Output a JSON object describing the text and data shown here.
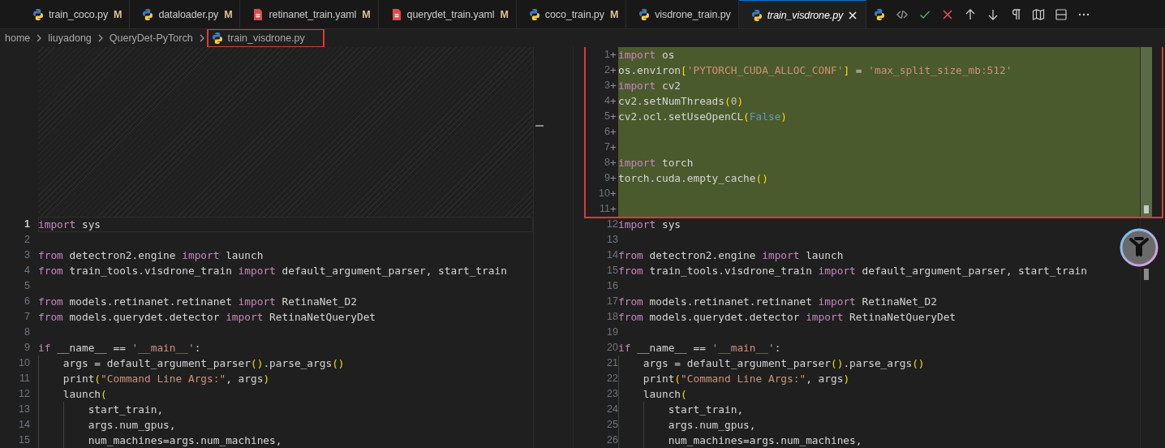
{
  "tabs": [
    {
      "label": "train_coco.py",
      "kind": "python",
      "status": "M",
      "selected": false,
      "preview": false
    },
    {
      "label": "dataloader.py",
      "kind": "python",
      "status": "M",
      "selected": false,
      "preview": false
    },
    {
      "label": "retinanet_train.yaml",
      "kind": "yaml",
      "status": "M",
      "selected": false,
      "preview": false
    },
    {
      "label": "querydet_train.yaml",
      "kind": "yaml",
      "status": "M",
      "selected": false,
      "preview": false
    },
    {
      "label": "coco_train.py",
      "kind": "python",
      "status": "M",
      "selected": false,
      "preview": false
    },
    {
      "label": "visdrone_train.py",
      "kind": "python",
      "selected": false,
      "preview": false
    },
    {
      "label": "train_visdrone.py",
      "kind": "python",
      "selected": true,
      "preview": true
    }
  ],
  "toolbar": [
    {
      "kind": "python"
    },
    {
      "kind": "code"
    },
    {
      "kind": "accept"
    },
    {
      "kind": "reject"
    },
    {
      "kind": "up"
    },
    {
      "kind": "down"
    },
    {
      "kind": "pilcrow"
    },
    {
      "kind": "map"
    },
    {
      "kind": "split"
    },
    {
      "kind": "more"
    }
  ],
  "breadcrumb": [
    {
      "label": "home",
      "kind": "folder"
    },
    {
      "label": "liuyadong",
      "kind": "folder"
    },
    {
      "label": "QueryDet-PyTorch",
      "kind": "folder"
    },
    {
      "label": "train_visdrone.py",
      "kind": "python",
      "annotated": true
    }
  ],
  "left_pane": {
    "lines": [
      {
        "number": "1",
        "current": true,
        "tokens": [
          {
            "kind": "kw",
            "text": "import"
          },
          {
            "kind": "plain",
            "text": " sys"
          }
        ]
      },
      {
        "number": "2",
        "current": false
      },
      {
        "number": "3",
        "current": false,
        "tokens": [
          {
            "kind": "kw",
            "text": "from"
          },
          {
            "kind": "plain",
            "text": " detectron2.engine "
          },
          {
            "kind": "kw",
            "text": "import"
          },
          {
            "kind": "plain",
            "text": " launch"
          }
        ]
      },
      {
        "number": "4",
        "current": false,
        "tokens": [
          {
            "kind": "kw",
            "text": "from"
          },
          {
            "kind": "plain",
            "text": " train_tools.visdrone_train "
          },
          {
            "kind": "kw",
            "text": "import"
          },
          {
            "kind": "plain",
            "text": " default_argument_parser, start_train"
          }
        ]
      },
      {
        "number": "5",
        "current": false
      },
      {
        "number": "6",
        "current": false,
        "tokens": [
          {
            "kind": "kw",
            "text": "from"
          },
          {
            "kind": "plain",
            "text": " models.retinanet.retinanet "
          },
          {
            "kind": "kw",
            "text": "import"
          },
          {
            "kind": "plain",
            "text": " RetinaNet_D2"
          }
        ]
      },
      {
        "number": "7",
        "current": false,
        "tokens": [
          {
            "kind": "kw",
            "text": "from"
          },
          {
            "kind": "plain",
            "text": " models.querydet.detector "
          },
          {
            "kind": "kw",
            "text": "import"
          },
          {
            "kind": "plain",
            "text": " RetinaNetQueryDet"
          }
        ]
      },
      {
        "number": "8",
        "current": false
      },
      {
        "number": "9",
        "current": false,
        "tokens": [
          {
            "kind": "kw",
            "text": "if"
          },
          {
            "kind": "plain",
            "text": " __name__ == "
          },
          {
            "kind": "str",
            "text": "'__main__'"
          },
          {
            "kind": "plain",
            "text": ":"
          }
        ]
      },
      {
        "number": "10",
        "current": false,
        "tokens": [
          {
            "kind": "plain",
            "text": "    args = default_argument_parser"
          },
          {
            "kind": "bracket",
            "text": "()"
          },
          {
            "kind": "plain",
            "text": ".parse_args"
          },
          {
            "kind": "bracket",
            "text": "()"
          }
        ]
      },
      {
        "number": "11",
        "current": false,
        "tokens": [
          {
            "kind": "plain",
            "text": "    print"
          },
          {
            "kind": "bracket",
            "text": "("
          },
          {
            "kind": "str",
            "text": "\"Command Line Args:\""
          },
          {
            "kind": "plain",
            "text": ", args"
          },
          {
            "kind": "bracket",
            "text": ")"
          }
        ]
      },
      {
        "number": "12",
        "current": false,
        "tokens": [
          {
            "kind": "plain",
            "text": "    launch"
          },
          {
            "kind": "bracket",
            "text": "("
          }
        ]
      },
      {
        "number": "13",
        "current": false,
        "tokens": [
          {
            "kind": "plain",
            "text": "        start_train,"
          }
        ]
      },
      {
        "number": "14",
        "current": false,
        "tokens": [
          {
            "kind": "plain",
            "text": "        args.num_gpus,"
          }
        ]
      },
      {
        "number": "15",
        "current": false,
        "tokens": [
          {
            "kind": "plain",
            "text": "        num_machines=args.num_machines,"
          }
        ]
      }
    ]
  },
  "right_pane": {
    "annotated": true,
    "lines": [
      {
        "number": "1",
        "marker": "+",
        "added": true,
        "tokens": [
          {
            "kind": "kw",
            "text": "import"
          },
          {
            "kind": "plain",
            "text": " os"
          }
        ]
      },
      {
        "number": "2",
        "marker": "+",
        "added": true,
        "tokens": [
          {
            "kind": "plain",
            "text": "os.environ"
          },
          {
            "kind": "bracket",
            "text": "["
          },
          {
            "kind": "str",
            "text": "'PYTORCH_CUDA_ALLOC_CONF'"
          },
          {
            "kind": "bracket",
            "text": "]"
          },
          {
            "kind": "plain",
            "text": " = "
          },
          {
            "kind": "str",
            "text": "'max_split_size_mb:512'"
          }
        ]
      },
      {
        "number": "3",
        "marker": "+",
        "added": true,
        "tokens": [
          {
            "kind": "kw",
            "text": "import"
          },
          {
            "kind": "plain",
            "text": " cv2"
          }
        ]
      },
      {
        "number": "4",
        "marker": "+",
        "added": true,
        "tokens": [
          {
            "kind": "plain",
            "text": "cv2.setNumThreads"
          },
          {
            "kind": "bracket",
            "text": "("
          },
          {
            "kind": "num",
            "text": "0"
          },
          {
            "kind": "bracket",
            "text": ")"
          }
        ]
      },
      {
        "number": "5",
        "marker": "+",
        "added": true,
        "tokens": [
          {
            "kind": "plain",
            "text": "cv2.ocl.setUseOpenCL"
          },
          {
            "kind": "bracket",
            "text": "("
          },
          {
            "kind": "const",
            "text": "False"
          },
          {
            "kind": "bracket",
            "text": ")"
          }
        ]
      },
      {
        "number": "6",
        "marker": "+",
        "added": true
      },
      {
        "number": "7",
        "marker": "+",
        "added": true
      },
      {
        "number": "8",
        "marker": "+",
        "added": true,
        "tokens": [
          {
            "kind": "kw",
            "text": "import"
          },
          {
            "kind": "plain",
            "text": " torch"
          }
        ]
      },
      {
        "number": "9",
        "marker": "+",
        "added": true,
        "tokens": [
          {
            "kind": "plain",
            "text": "torch.cuda.empty_cache"
          },
          {
            "kind": "bracket",
            "text": "()"
          }
        ]
      },
      {
        "number": "10",
        "marker": "+",
        "added": true
      },
      {
        "number": "11",
        "marker": "+",
        "added": true
      },
      {
        "number": "12",
        "added": false,
        "tokens": [
          {
            "kind": "kw",
            "text": "import"
          },
          {
            "kind": "plain",
            "text": " sys"
          }
        ]
      },
      {
        "number": "13",
        "added": false
      },
      {
        "number": "14",
        "added": false,
        "tokens": [
          {
            "kind": "kw",
            "text": "from"
          },
          {
            "kind": "plain",
            "text": " detectron2.engine "
          },
          {
            "kind": "kw",
            "text": "import"
          },
          {
            "kind": "plain",
            "text": " launch"
          }
        ]
      },
      {
        "number": "15",
        "added": false,
        "tokens": [
          {
            "kind": "kw",
            "text": "from"
          },
          {
            "kind": "plain",
            "text": " train_tools.visdrone_train "
          },
          {
            "kind": "kw",
            "text": "import"
          },
          {
            "kind": "plain",
            "text": " default_argument_parser, start_train"
          }
        ]
      },
      {
        "number": "16",
        "added": false
      },
      {
        "number": "17",
        "added": false,
        "tokens": [
          {
            "kind": "kw",
            "text": "from"
          },
          {
            "kind": "plain",
            "text": " models.retinanet.retinanet "
          },
          {
            "kind": "kw",
            "text": "import"
          },
          {
            "kind": "plain",
            "text": " RetinaNet_D2"
          }
        ]
      },
      {
        "number": "18",
        "added": false,
        "tokens": [
          {
            "kind": "kw",
            "text": "from"
          },
          {
            "kind": "plain",
            "text": " models.querydet.detector "
          },
          {
            "kind": "kw",
            "text": "import"
          },
          {
            "kind": "plain",
            "text": " RetinaNetQueryDet"
          }
        ]
      },
      {
        "number": "19",
        "added": false
      },
      {
        "number": "20",
        "added": false,
        "tokens": [
          {
            "kind": "kw",
            "text": "if"
          },
          {
            "kind": "plain",
            "text": " __name__ == "
          },
          {
            "kind": "str",
            "text": "'__main__'"
          },
          {
            "kind": "plain",
            "text": ":"
          }
        ]
      },
      {
        "number": "21",
        "added": false,
        "tokens": [
          {
            "kind": "plain",
            "text": "    args = default_argument_parser"
          },
          {
            "kind": "bracket",
            "text": "()"
          },
          {
            "kind": "plain",
            "text": ".parse_args"
          },
          {
            "kind": "bracket",
            "text": "()"
          }
        ]
      },
      {
        "number": "22",
        "added": false,
        "tokens": [
          {
            "kind": "plain",
            "text": "    print"
          },
          {
            "kind": "bracket",
            "text": "("
          },
          {
            "kind": "str",
            "text": "\"Command Line Args:\""
          },
          {
            "kind": "plain",
            "text": ", args"
          },
          {
            "kind": "bracket",
            "text": ")"
          }
        ]
      },
      {
        "number": "23",
        "added": false,
        "tokens": [
          {
            "kind": "plain",
            "text": "    launch"
          },
          {
            "kind": "bracket",
            "text": "("
          }
        ]
      },
      {
        "number": "24",
        "added": false,
        "tokens": [
          {
            "kind": "plain",
            "text": "        start_train,"
          }
        ]
      },
      {
        "number": "25",
        "added": false,
        "tokens": [
          {
            "kind": "plain",
            "text": "        args.num_gpus,"
          }
        ]
      },
      {
        "number": "26",
        "added": false,
        "tokens": [
          {
            "kind": "plain",
            "text": "        num_machines=args.num_machines,"
          }
        ]
      }
    ]
  }
}
